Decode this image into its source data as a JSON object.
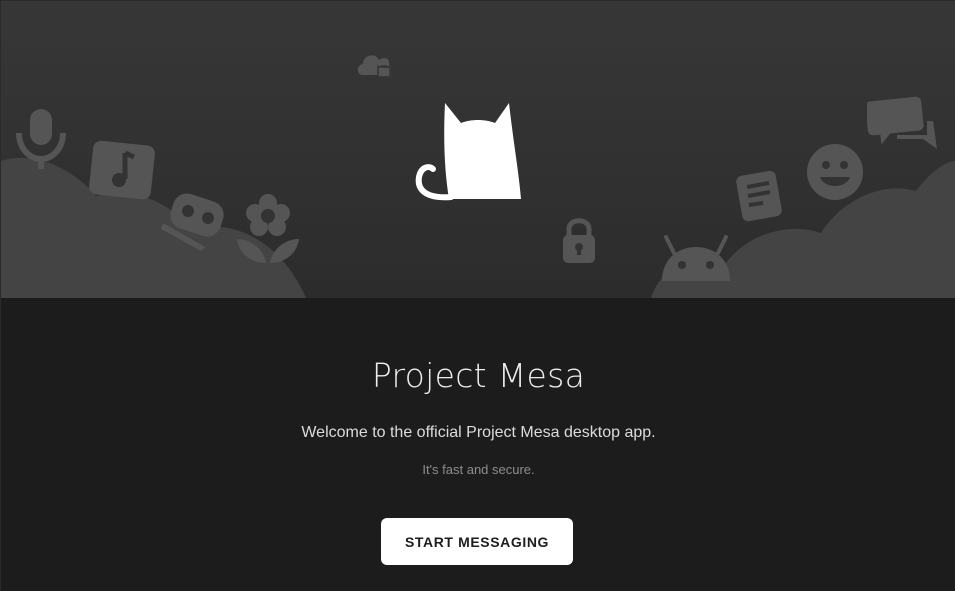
{
  "app": {
    "title": "Project Mesa",
    "welcome": "Welcome to the official Project Mesa desktop app.",
    "tagline": "It's fast and secure.",
    "start_button": "START MESSAGING"
  },
  "illustration": {
    "icons": [
      "cloud-lock-icon",
      "microphone-icon",
      "music-note-icon",
      "robot-icon",
      "flower-icon",
      "cat-logo-icon",
      "lock-icon",
      "android-icon",
      "document-icon",
      "smiley-icon",
      "chat-bubbles-icon"
    ]
  },
  "colors": {
    "background": "#1c1c1c",
    "hero": "#333333",
    "icon": "#555555",
    "button_bg": "#ffffff",
    "button_text": "#1e1e1e"
  }
}
